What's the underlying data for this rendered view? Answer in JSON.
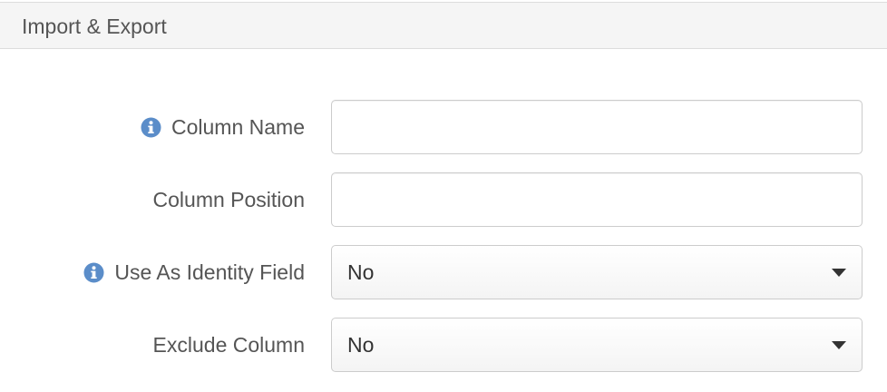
{
  "panel": {
    "title": "Import & Export"
  },
  "form": {
    "column_name": {
      "label": "Column Name",
      "value": "",
      "placeholder": "",
      "has_info_icon": true
    },
    "column_position": {
      "label": "Column Position",
      "value": "",
      "placeholder": "",
      "has_info_icon": false
    },
    "use_as_identity_field": {
      "label": "Use As Identity Field",
      "selected": "No",
      "has_info_icon": true
    },
    "exclude_column": {
      "label": "Exclude Column",
      "selected": "No",
      "has_info_icon": false
    }
  },
  "icons": {
    "info": "info-circle-icon",
    "dropdown": "caret-down-icon"
  },
  "colors": {
    "info_icon": "#5b8dc9",
    "label_text": "#555555",
    "header_bg": "#f5f5f5",
    "border": "#cccccc"
  }
}
